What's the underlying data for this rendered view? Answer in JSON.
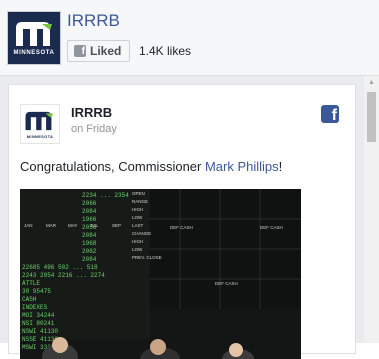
{
  "page": {
    "name": "IRRRB",
    "logo_text": "MINNESOTA",
    "liked_label": "Liked",
    "likes_count": "1.4K likes"
  },
  "post": {
    "author": "IRRRB",
    "time": "on Friday",
    "text_before": "Congratulations, Commissioner ",
    "mention": "Mark Phillips",
    "text_after": "!",
    "logo_text": "MINNESOTA"
  },
  "photo_board": {
    "rows": [
      "2234 ... 2354",
      "2066",
      "2084",
      "1966",
      "2056",
      "2084",
      "1968",
      "2062",
      "2084",
      "22685 496 502 ... 518",
      "2243 2054 2216 ... 2274",
      "ATTLE",
      "30 95475",
      "CASH",
      "INDEXES",
      "MOI 34244",
      "NSI 80241",
      "NSWI 41130",
      "NSSE 41136",
      "MSWI 33321"
    ],
    "labels": [
      "OPEN",
      "RANGE",
      "HIGH",
      "LOW",
      "LAST",
      "CHANGE",
      "HIGH",
      "LOW",
      "PREV. CLOSE"
    ],
    "months": [
      "JAN",
      "MAR",
      "MAY",
      "JUL",
      "SEP"
    ],
    "wide_labels": [
      "DEF CASH",
      "DEF CASH",
      "DEF CASH"
    ]
  },
  "colors": {
    "link": "#3b5998",
    "logo_bg": "#1a2b4f",
    "logo_accent": "#7cc242",
    "board_green": "#6ad36a"
  }
}
